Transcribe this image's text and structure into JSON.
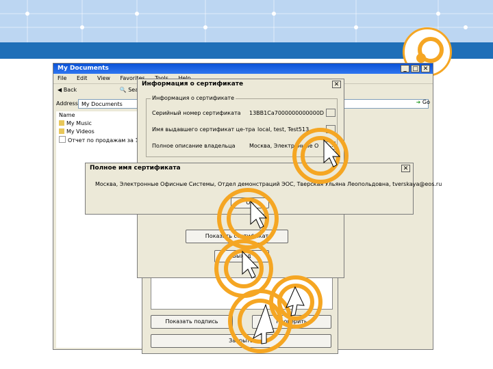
{
  "mydocs": {
    "title": "My Documents",
    "menu": [
      "File",
      "Edit",
      "View",
      "Favorites",
      "Tools",
      "Help"
    ],
    "toolbar": {
      "back": "Back",
      "search": "Search"
    },
    "address_label": "Address",
    "address_value": "My Documents",
    "go_label": "Go",
    "column_name": "Name",
    "files": [
      "My Music",
      "My Videos",
      "Отчет по продажам за 1 кв 21"
    ]
  },
  "certwin": {
    "title": "Информация о сертификате",
    "group": "Информация о сертификате",
    "serial_label": "Серийный номер сертификата",
    "serial_value": "13BB1Ca7000000000000D",
    "issuer_label": "Имя выдавшего сертификат це-тра",
    "issuer_value": "local, test, Test513",
    "subject_label": "Полное описание владельца",
    "subject_value": "Москва, Электронные О",
    "more_button": "...",
    "show_button": "Показать сертификат",
    "exit_button": "Выход"
  },
  "fullwin": {
    "title": "Полное имя сертификата",
    "text": "Москва, Электронные Офисные Системы, Отдел демонстраций ЭОС, Тверская Ульяна Леопольдовна, tverskaya@eos.ru",
    "ok_button": "OK"
  },
  "backwin": {
    "show_sig_button": "Показать подпись",
    "check_button": "Проверить",
    "close_button": "Закрыть"
  },
  "colors": {
    "accent_orange": "#f5a623",
    "xp_blue": "#0a52d6",
    "banner_blue": "#1f6fb8"
  }
}
